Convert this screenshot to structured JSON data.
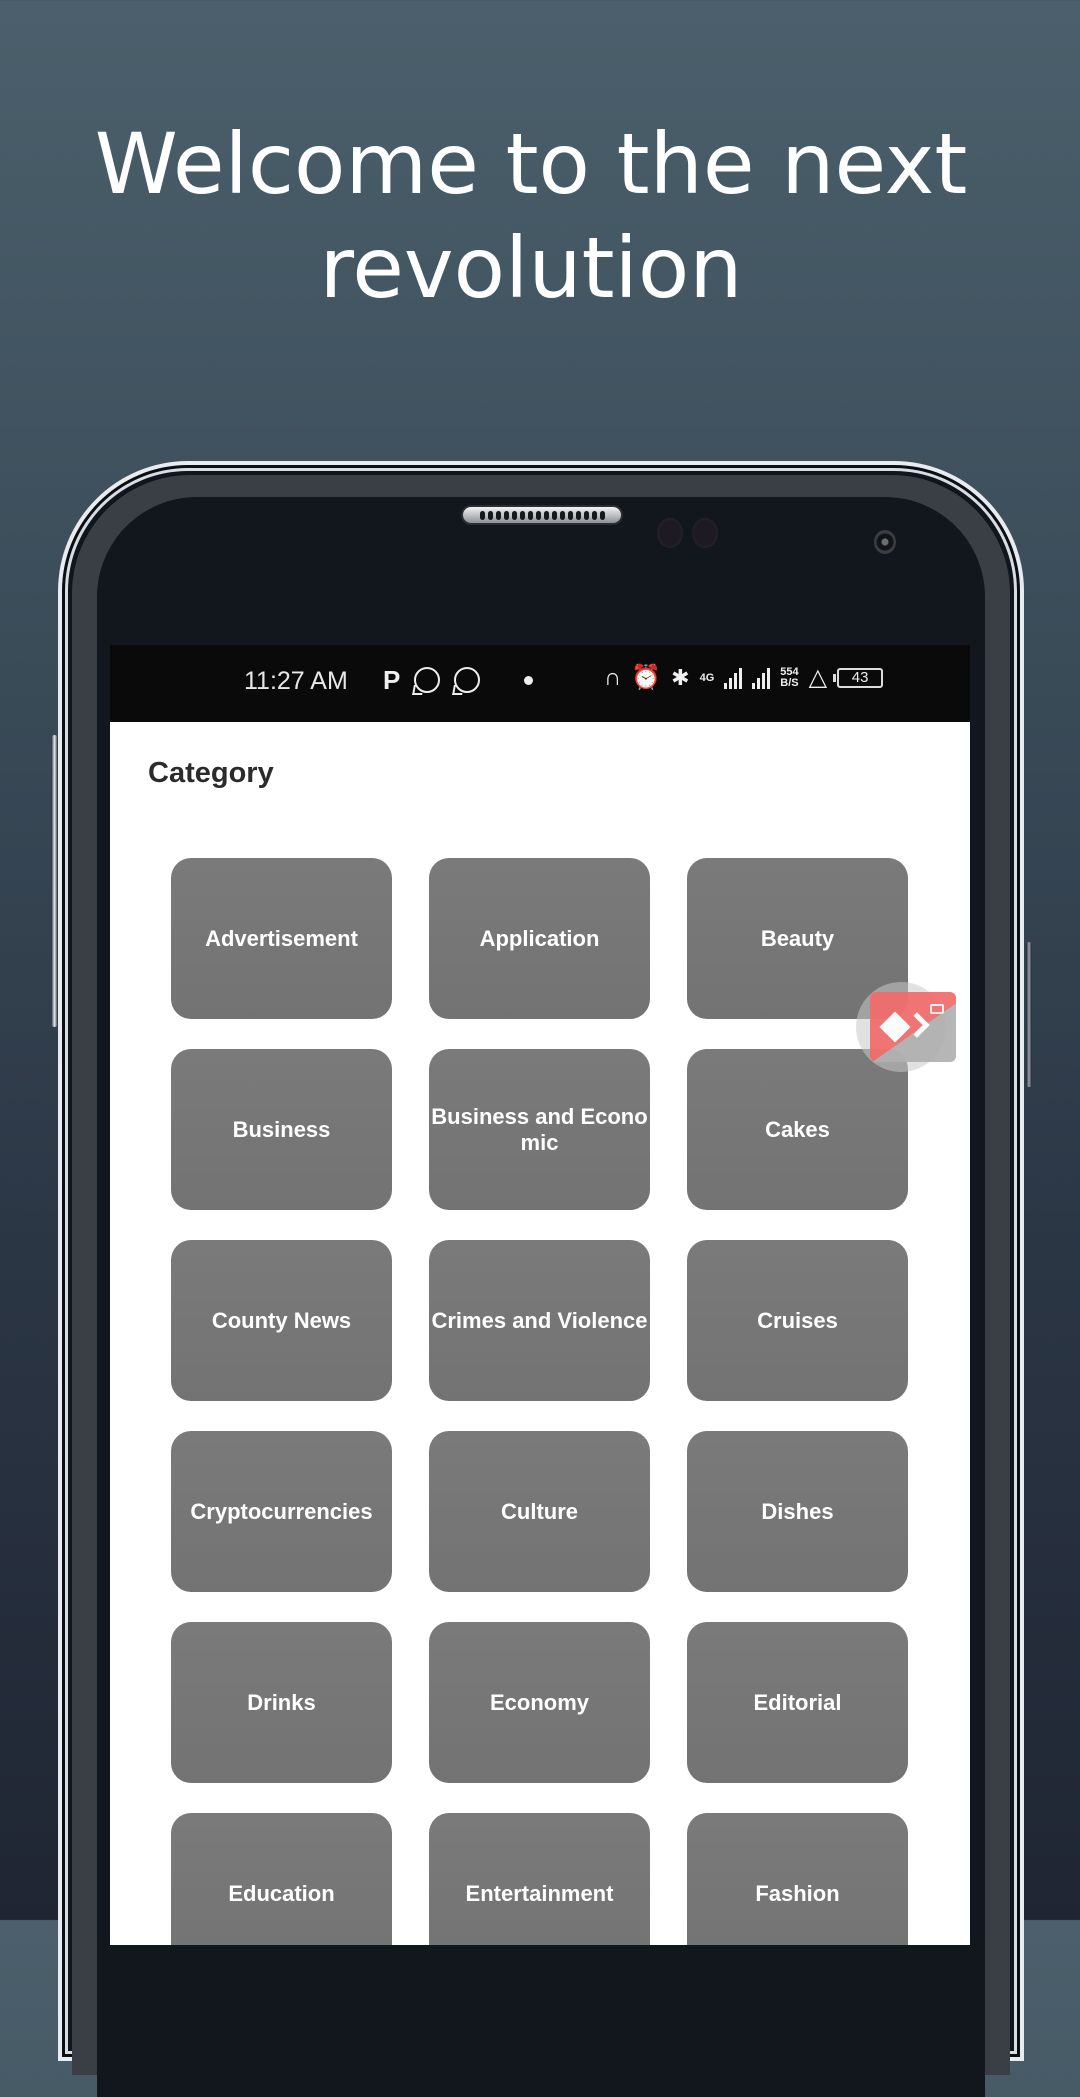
{
  "promo": {
    "headline": "Welcome to the next revolution"
  },
  "statusbar": {
    "time": "11:27 AM",
    "left_icons": [
      "parking-app-icon",
      "whatsapp-icon",
      "whatsapp-business-icon",
      "notification-dot-icon"
    ],
    "right_icons": [
      "headphones-icon",
      "alarm-icon",
      "bluetooth-icon",
      "4g-signal-icon",
      "signal-icon",
      "network-speed-icon",
      "lab-icon",
      "battery-icon"
    ],
    "network_type": "4G",
    "net_speed_value": "554",
    "net_speed_unit": "B/S",
    "battery_level": "43"
  },
  "app": {
    "page_title": "Category",
    "tile_color": "#787878",
    "categories": [
      {
        "label": "Advertisement"
      },
      {
        "label": "Application"
      },
      {
        "label": "Beauty"
      },
      {
        "label": "Business"
      },
      {
        "label": "Business and Economic"
      },
      {
        "label": "Cakes"
      },
      {
        "label": "County News"
      },
      {
        "label": "Crimes and Violence"
      },
      {
        "label": "Cruises"
      },
      {
        "label": "Cryptocurrencies"
      },
      {
        "label": "Culture"
      },
      {
        "label": "Dishes"
      },
      {
        "label": "Drinks"
      },
      {
        "label": "Economy"
      },
      {
        "label": "Editorial"
      },
      {
        "label": "Education"
      },
      {
        "label": "Entertainment"
      },
      {
        "label": "Fashion"
      }
    ]
  },
  "floating_widget": {
    "icon": "anydesk-icon",
    "accent": "#f26b6b"
  }
}
